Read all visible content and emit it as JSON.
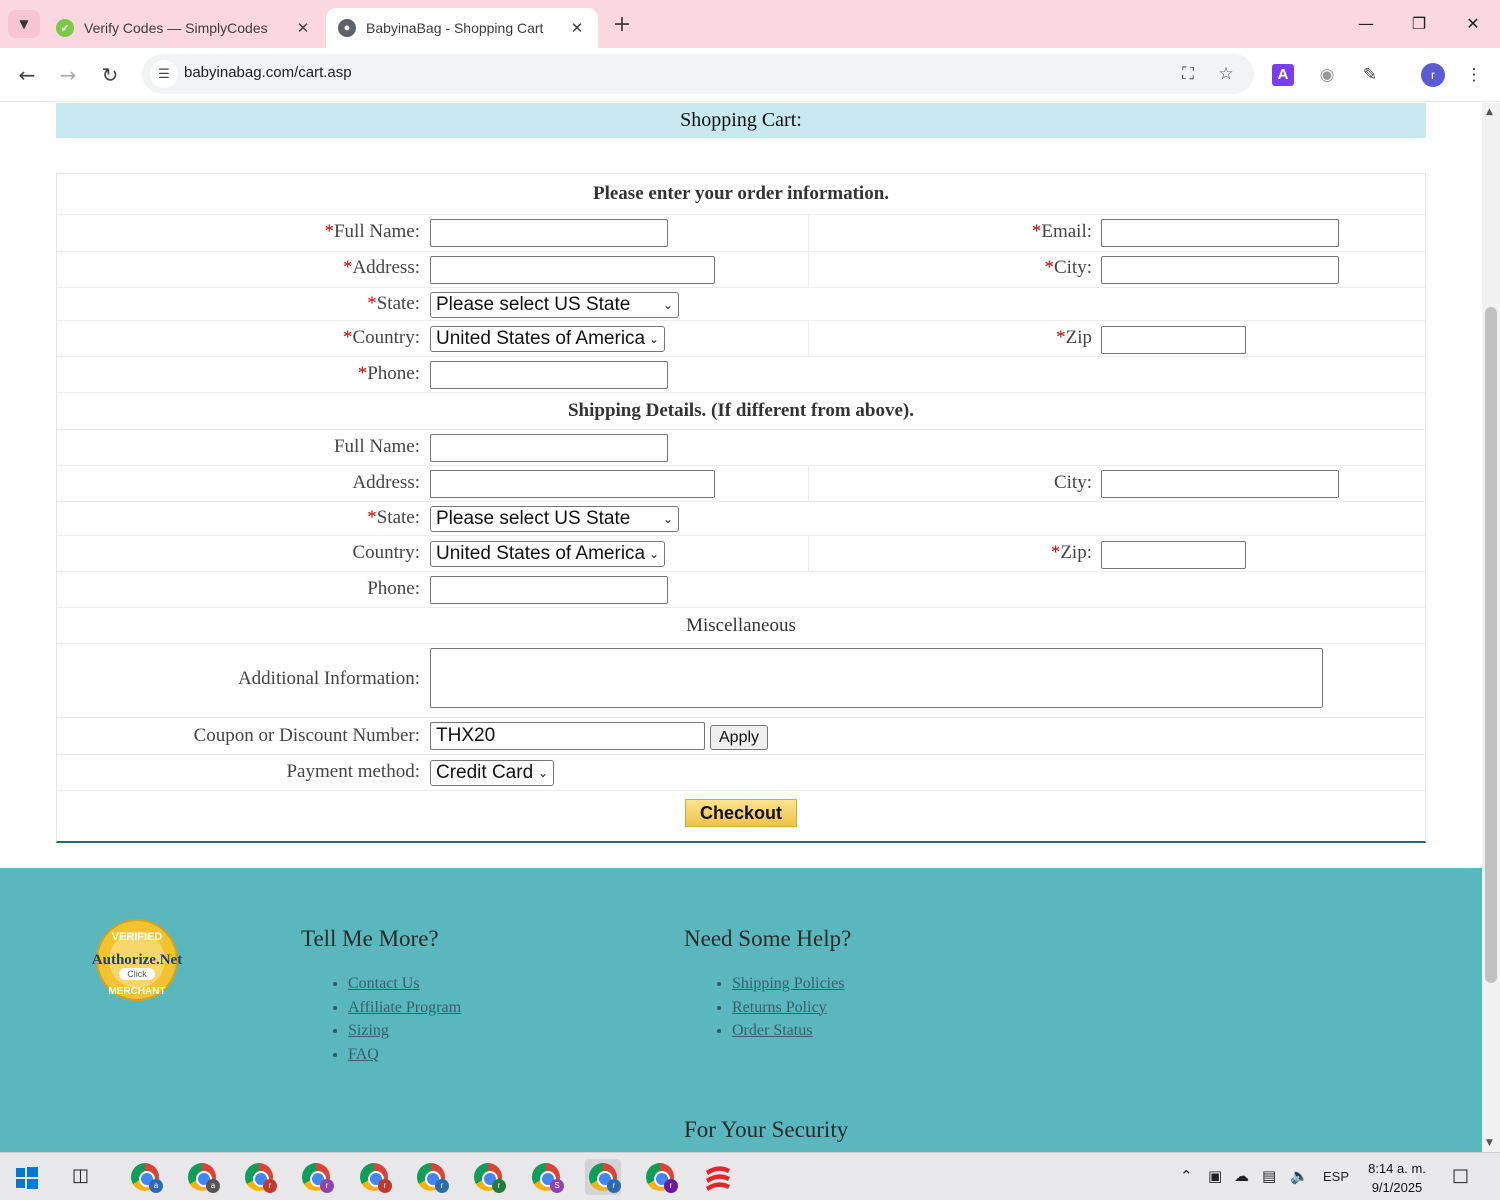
{
  "browser": {
    "tabs": [
      {
        "title": "Verify Codes — SimplyCodes",
        "active": false,
        "icon": "simplycodes-icon"
      },
      {
        "title": "BabyinaBag - Shopping Cart",
        "active": true,
        "icon": "globe-icon"
      }
    ],
    "url": "babyinabag.com/cart.asp",
    "profile_initial": "r",
    "extension_letter": "A"
  },
  "page": {
    "header": "Shopping Cart:",
    "order_section": "Please enter your order information.",
    "billing": {
      "full_name": {
        "label": "Full Name:",
        "required": "*",
        "value": ""
      },
      "email": {
        "label": "Email:",
        "required": "*",
        "value": ""
      },
      "address": {
        "label": "Address:",
        "required": "*",
        "value": ""
      },
      "city": {
        "label": "City:",
        "required": "*",
        "value": ""
      },
      "state": {
        "label": "State:",
        "required": "*",
        "selected": "Please select US State"
      },
      "country": {
        "label": "Country:",
        "required": "*",
        "selected": "United States of America"
      },
      "zip": {
        "label": "Zip",
        "required": "*",
        "value": ""
      },
      "phone": {
        "label": "Phone:",
        "required": "*",
        "value": ""
      }
    },
    "shipping_section": "Shipping Details. (If different from above).",
    "shipping": {
      "full_name": {
        "label": "Full Name:",
        "value": ""
      },
      "address": {
        "label": "Address:",
        "value": ""
      },
      "city": {
        "label": "City:",
        "value": ""
      },
      "state": {
        "label": "State:",
        "required": "*",
        "selected": "Please select US State"
      },
      "country": {
        "label": "Country:",
        "selected": "United States of America"
      },
      "zip": {
        "label": "Zip:",
        "required": "*",
        "value": ""
      },
      "phone": {
        "label": "Phone:",
        "value": ""
      }
    },
    "misc_section": "Miscellaneous",
    "additional_info": {
      "label": "Additional Information:",
      "value": ""
    },
    "coupon": {
      "label": "Coupon or Discount Number:",
      "value": "THX20",
      "apply_label": "Apply"
    },
    "payment": {
      "label": "Payment method:",
      "selected": "Credit Card"
    },
    "checkout_label": "Checkout"
  },
  "footer": {
    "badge": {
      "top": "VERIFIED",
      "brand": "Authorize.Net",
      "click": "Click",
      "bottom": "MERCHANT"
    },
    "col1": {
      "heading": "Tell Me More?",
      "links": [
        "Contact Us",
        "Affiliate Program",
        "Sizing",
        "FAQ"
      ]
    },
    "col2": {
      "heading": "Need Some Help?",
      "links": [
        "Shipping Policies",
        "Returns Policy",
        "Order Status"
      ]
    },
    "security_heading": "For Your Security"
  },
  "taskbar": {
    "apps": [
      {
        "letter": "a",
        "color": "#2b6cb0"
      },
      {
        "letter": "a",
        "color": "#555555"
      },
      {
        "letter": "r",
        "color": "#c0392b"
      },
      {
        "letter": "r",
        "color": "#8e44ad"
      },
      {
        "letter": "r",
        "color": "#c0392b"
      },
      {
        "letter": "r",
        "color": "#2b6cb0"
      },
      {
        "letter": "r",
        "color": "#1e7d3a"
      },
      {
        "letter": "S",
        "color": "#8e44ad"
      },
      {
        "letter": "r",
        "color": "#2b6cb0"
      },
      {
        "letter": "r",
        "color": "#6a1b9a"
      }
    ],
    "language": "ESP",
    "time": "8:14 a. m.",
    "date": "9/1/2025"
  },
  "colors": {
    "accent": "#59b7bd",
    "header_bg": "#c8e9ef",
    "required": "#c00000",
    "tabbar": "#fbd7df"
  }
}
